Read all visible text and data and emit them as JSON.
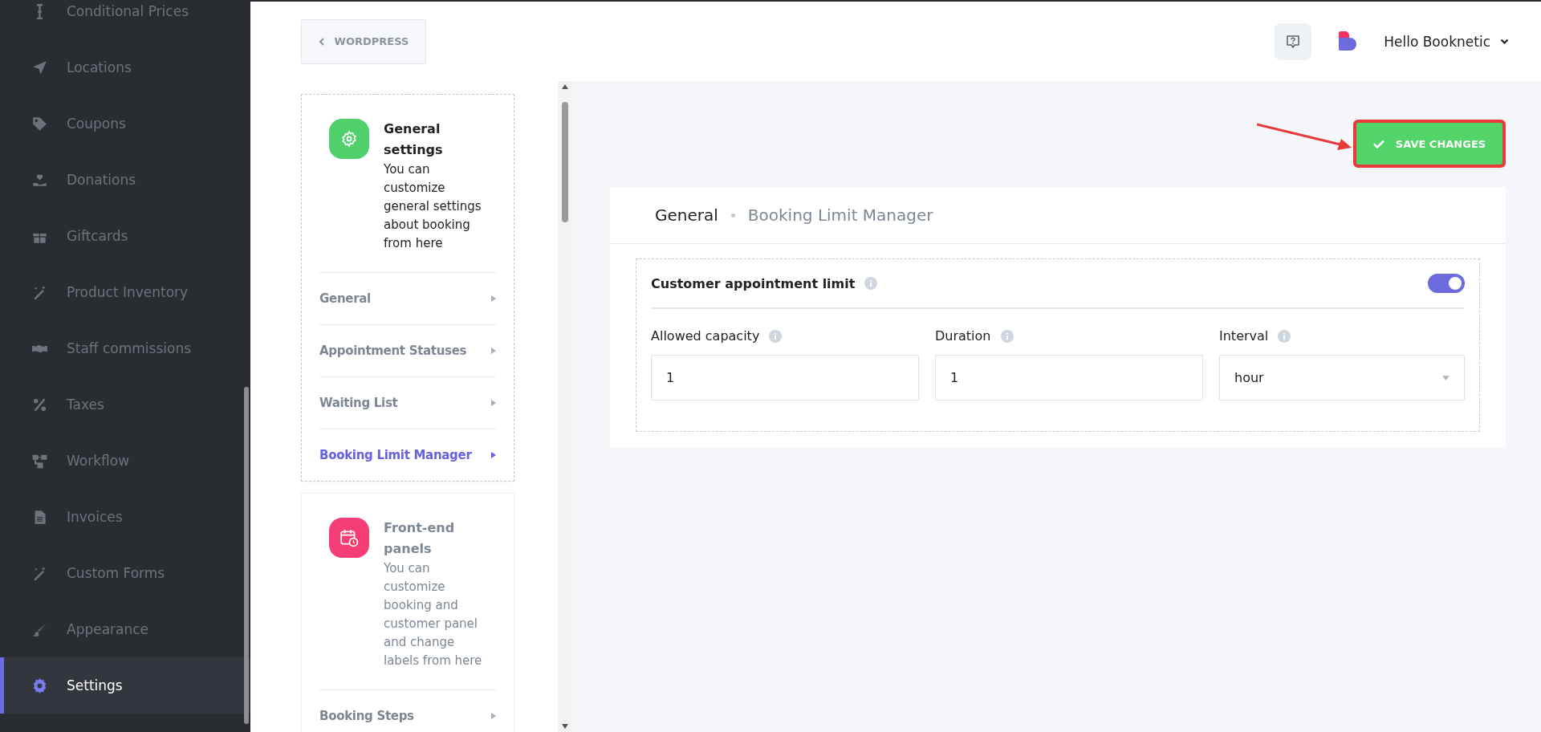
{
  "sidebar": {
    "items": [
      {
        "label": "Conditional Prices",
        "selected": false
      },
      {
        "label": "Locations",
        "selected": false
      },
      {
        "label": "Coupons",
        "selected": false
      },
      {
        "label": "Donations",
        "selected": false
      },
      {
        "label": "Giftcards",
        "selected": false
      },
      {
        "label": "Product Inventory",
        "selected": false
      },
      {
        "label": "Staff commissions",
        "selected": false
      },
      {
        "label": "Taxes",
        "selected": false
      },
      {
        "label": "Workflow",
        "selected": false
      },
      {
        "label": "Invoices",
        "selected": false
      },
      {
        "label": "Custom Forms",
        "selected": false
      },
      {
        "label": "Appearance",
        "selected": false
      },
      {
        "label": "Settings",
        "selected": true
      }
    ]
  },
  "top_bar": {
    "back_button": "WORDPRESS",
    "user_name": "Hello Booknetic"
  },
  "settings_groups": [
    {
      "title": "General settings",
      "description": "You can customize general settings about booking from here",
      "active": true,
      "items": [
        {
          "label": "General",
          "selected": false
        },
        {
          "label": "Appointment Statuses",
          "selected": false
        },
        {
          "label": "Waiting List",
          "selected": false
        },
        {
          "label": "Booking Limit Manager",
          "selected": true
        }
      ]
    },
    {
      "title": "Front-end panels",
      "description": "You can customize booking and customer panel and change labels from here",
      "active": false,
      "items": [
        {
          "label": "Booking Steps",
          "selected": false
        }
      ]
    }
  ],
  "save_button": "SAVE CHANGES",
  "panel": {
    "breadcrumb": [
      "General",
      "Booking Limit Manager"
    ],
    "section": {
      "title": "Customer appointment limit",
      "on": true
    },
    "fields": [
      {
        "kind": "input",
        "label": "Allowed capacity",
        "value": "1"
      },
      {
        "kind": "input",
        "label": "Duration",
        "value": "1"
      },
      {
        "kind": "select",
        "label": "Interval",
        "value": "hour"
      }
    ]
  }
}
